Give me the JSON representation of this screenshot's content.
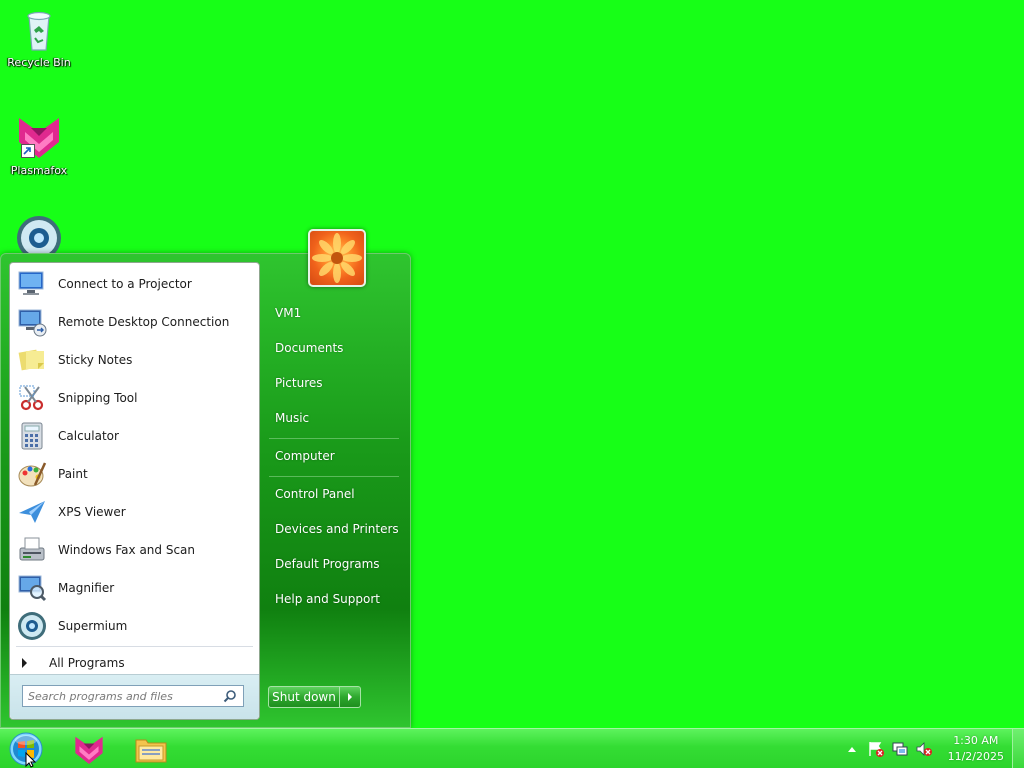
{
  "desktop": {
    "icons": [
      {
        "label": "Recycle Bin",
        "icon": "recycle-bin-icon"
      },
      {
        "label": "Plasmafox",
        "icon": "plasmafox-icon"
      },
      {
        "label": "",
        "icon": "supermium-icon"
      }
    ]
  },
  "start_menu": {
    "programs": [
      {
        "label": "Connect to a Projector",
        "icon": "projector-icon"
      },
      {
        "label": "Remote Desktop Connection",
        "icon": "remote-desktop-icon"
      },
      {
        "label": "Sticky Notes",
        "icon": "sticky-notes-icon"
      },
      {
        "label": "Snipping Tool",
        "icon": "snipping-tool-icon"
      },
      {
        "label": "Calculator",
        "icon": "calculator-icon"
      },
      {
        "label": "Paint",
        "icon": "paint-icon"
      },
      {
        "label": "XPS Viewer",
        "icon": "xps-viewer-icon"
      },
      {
        "label": "Windows Fax and Scan",
        "icon": "fax-scan-icon"
      },
      {
        "label": "Magnifier",
        "icon": "magnifier-icon"
      },
      {
        "label": "Supermium",
        "icon": "supermium-icon"
      }
    ],
    "all_programs": "All Programs",
    "search_placeholder": "Search programs and files",
    "right_links": {
      "user": "VM1",
      "documents": "Documents",
      "pictures": "Pictures",
      "music": "Music",
      "computer": "Computer",
      "control_panel": "Control Panel",
      "devices_printers": "Devices and Printers",
      "default_programs": "Default Programs",
      "help_support": "Help and Support"
    },
    "shutdown": "Shut down"
  },
  "taskbar": {
    "pinned": [
      "plasmafox-icon",
      "explorer-folder-icon"
    ],
    "clock_time": "1:30 AM",
    "clock_date": "11/2/2025"
  },
  "colors": {
    "desktop": "#17ff17",
    "taskbar": "#34dd34",
    "start_menu": "#1a9b1a"
  }
}
